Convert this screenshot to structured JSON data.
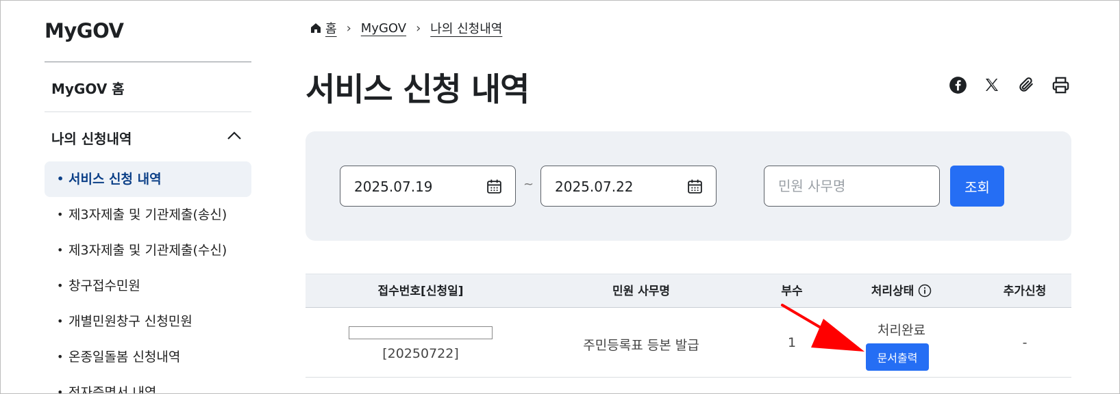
{
  "sidebar": {
    "logo": "MyGOV",
    "home_label": "MyGOV 홈",
    "section_label": "나의 신청내역",
    "items": [
      {
        "label": "서비스 신청 내역",
        "active": true
      },
      {
        "label": "제3자제출 및 기관제출(송신)"
      },
      {
        "label": "제3자제출 및 기관제출(수신)"
      },
      {
        "label": "창구접수민원"
      },
      {
        "label": "개별민원창구 신청민원"
      },
      {
        "label": "온종일돌봄 신청내역"
      },
      {
        "label": "전자증명서 내역"
      }
    ]
  },
  "breadcrumb": [
    "홈",
    "MyGOV",
    "나의 신청내역"
  ],
  "page": {
    "title": "서비스 신청 내역"
  },
  "share_icons": [
    "facebook-icon",
    "x-twitter-icon",
    "paperclip-icon",
    "printer-icon"
  ],
  "search": {
    "start_date": "2025.07.19",
    "end_date": "2025.07.22",
    "separator": "~",
    "keyword_placeholder": "민원 사무명",
    "keyword_value": "",
    "button_label": "조회"
  },
  "table": {
    "headers": [
      "접수번호[신청일]",
      "민원 사무명",
      "부수",
      "처리상태",
      "추가신청"
    ],
    "rows": [
      {
        "receipt_date": "[20250722]",
        "service_name": "주민등록표 등본 발급",
        "copies": "1",
        "status": "처리완료",
        "action_label": "문서출력",
        "extra": "-"
      }
    ]
  },
  "colors": {
    "primary": "#256ef4",
    "active_nav": "#0b3f87",
    "panel_bg": "#eef1f5",
    "annotation_arrow": "#ff0000"
  }
}
